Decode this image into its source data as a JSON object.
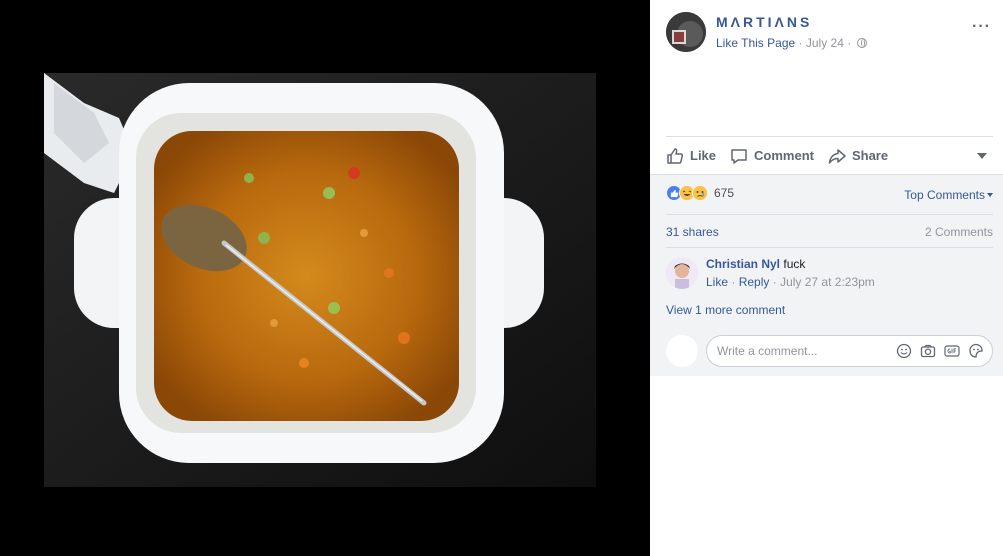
{
  "post": {
    "page_name": "MΛRTIΛNS",
    "like_page": "Like This Page",
    "date": "July 24",
    "dot": "·",
    "more": "···"
  },
  "actions": {
    "like": "Like",
    "comment": "Comment",
    "share": "Share"
  },
  "stats": {
    "reaction_count": "675",
    "top_comments": "Top Comments",
    "shares": "31 shares",
    "comments": "2 Comments"
  },
  "comment": {
    "author": "Christian Nyl",
    "text": "fuck",
    "like": "Like",
    "reply": "Reply",
    "timestamp": "July 27 at 2:23pm"
  },
  "view_more": "View 1 more comment",
  "composer": {
    "placeholder": "Write a comment..."
  },
  "icons": [
    "like-reaction-icon",
    "haha-reaction-icon",
    "sad-reaction-icon",
    "emoji-icon",
    "camera-icon",
    "gif-icon",
    "sticker-icon",
    "globe-icon"
  ],
  "colors": {
    "link": "#365899",
    "muted": "#90949c",
    "panel_bg": "#f2f3f5"
  }
}
